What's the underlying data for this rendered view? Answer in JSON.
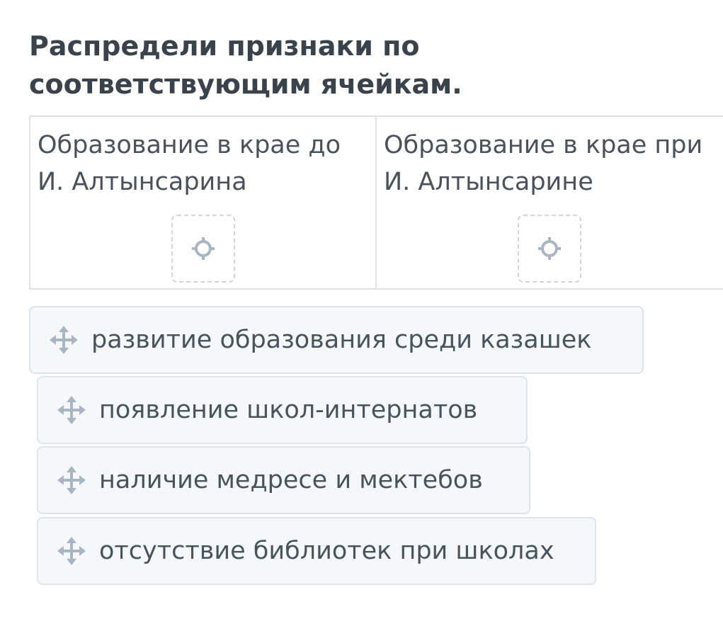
{
  "title": "Распредели признаки по соответствующим ячейкам.",
  "columns": [
    {
      "label": "Образование в крае до И. Алтынсарина",
      "drop_icon": "crosshair-icon"
    },
    {
      "label": "Образование в крае при И. Алтынсарине",
      "drop_icon": "crosshair-icon"
    }
  ],
  "items": [
    {
      "label": "развитие образования среди казашек",
      "icon": "move-icon"
    },
    {
      "label": "появление школ-интернатов",
      "icon": "move-icon"
    },
    {
      "label": "наличие медресе и мектебов",
      "icon": "move-icon"
    },
    {
      "label": "отсутствие библиотек при школах",
      "icon": "move-icon"
    }
  ],
  "colors": {
    "text": "#4a525c",
    "title": "#3a424c",
    "border": "#dfe3e7",
    "chip_bg": "#f4f8fb",
    "icon": "#a9b5c0"
  }
}
